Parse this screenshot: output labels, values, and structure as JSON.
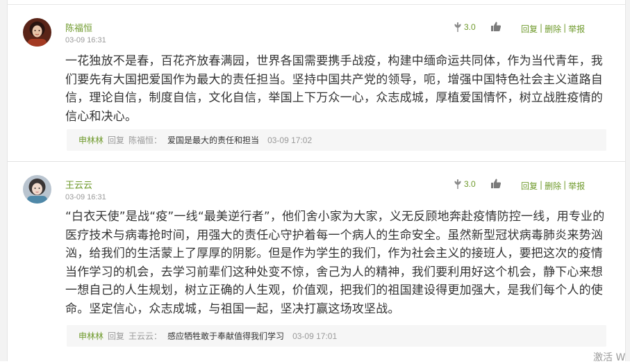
{
  "colors": {
    "accent": "#6f9a2c",
    "text": "#333333",
    "muted": "#999999"
  },
  "comments": [
    {
      "username": "陈福恒",
      "datetime": "03-09 16:31",
      "likes": "3.0",
      "actions": {
        "reply": "回复",
        "delete": "删除",
        "report": "举报",
        "sep": "|"
      },
      "body": "一花独放不是春，百花齐放春满园，世界各国需要携手战疫，构建中缅命运共同体，作为当代青年，我们要先有大国把爱国作为最大的责任担当。坚持中国共产党的领导，呃，增强中国特色社会主义道路自信，理论自信，制度自信，文化自信，举国上下万众一心，众志成城，厚植爱国情怀，树立战胜疫情的信心和决心。",
      "reply": {
        "name": "申林林",
        "word": "回复",
        "target": "陈福恒：",
        "text": "爱国是最大的责任和担当",
        "time": "03-09 17:02"
      }
    },
    {
      "username": "王云云",
      "datetime": "03-09 16:31",
      "likes": "3.0",
      "actions": {
        "reply": "回复",
        "delete": "删除",
        "report": "举报",
        "sep": "|"
      },
      "body": "“白衣天使”是战“疫”一线“最美逆行者”，他们舍小家为大家，义无反顾地奔赴疫情防控一线，用专业的医疗技术与病毒抢时间，用强大的责任心守护着每一个病人的生命安全。虽然新型冠状病毒肺炎来势汹汹，给我们的生活蒙上了厚厚的阴影。但是作为学生的我们，作为社会主义的接班人，要把这次的疫情当作学习的机会，去学习前辈们这种处变不惊，舍己为人的精神，我们要利用好这个机会，静下心来想一想自己的人生规划，树立正确的人生观，价值观，把我们的祖国建设得更加强大，是我们每个人的使命。坚定信心，众志成城，与祖国一起，坚决打赢这场攻坚战。",
      "reply": {
        "name": "申林林",
        "word": "回复",
        "target": "王云云：",
        "text": "感应牺牲敢于奉献值得我们学习",
        "time": "03-09 17:01"
      }
    }
  ],
  "watermark": "激活 W"
}
